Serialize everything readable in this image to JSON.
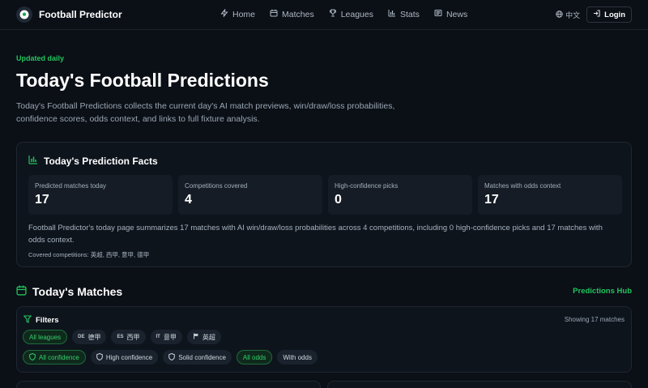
{
  "brand": {
    "name": "Football Predictor"
  },
  "nav": {
    "items": [
      {
        "label": "Home",
        "icon": "zap-icon"
      },
      {
        "label": "Matches",
        "icon": "calendar-icon"
      },
      {
        "label": "Leagues",
        "icon": "trophy-icon"
      },
      {
        "label": "Stats",
        "icon": "bar-chart-icon"
      },
      {
        "label": "News",
        "icon": "newspaper-icon"
      }
    ],
    "language": "中文",
    "login": "Login"
  },
  "hero": {
    "badge": "Updated daily",
    "title": "Today's Football Predictions",
    "lead": "Today's Football Predictions collects the current day's AI match previews, win/draw/loss probabilities, confidence scores, odds context, and links to full fixture analysis."
  },
  "facts": {
    "title": "Today's Prediction Facts",
    "items": [
      {
        "label": "Predicted matches today",
        "value": "17"
      },
      {
        "label": "Competitions covered",
        "value": "4"
      },
      {
        "label": "High-confidence picks",
        "value": "0"
      },
      {
        "label": "Matches with odds context",
        "value": "17"
      }
    ],
    "summary": "Football Predictor's today page summarizes 17 matches with AI win/draw/loss probabilities across 4 competitions, including 0 high-confidence picks and 17 matches with odds context.",
    "covered": "Covered competitions: 英超, 西甲, 意甲, 德甲"
  },
  "matches": {
    "title": "Today's Matches",
    "hub_link": "Predictions Hub"
  },
  "filters": {
    "title": "Filters",
    "showing": "Showing 17 matches",
    "leagues": [
      {
        "code": "",
        "label": "All leagues"
      },
      {
        "code": "DE",
        "label": "德甲"
      },
      {
        "code": "ES",
        "label": "西甲"
      },
      {
        "code": "IT",
        "label": "意甲"
      },
      {
        "code": "",
        "label": "英超"
      }
    ],
    "confidence": [
      "All confidence",
      "High confidence",
      "Solid confidence"
    ],
    "odds": [
      "All odds",
      "With odds"
    ]
  },
  "colors": {
    "accent": "#22c55e",
    "background": "#0b0f16",
    "card": "#0e141c"
  }
}
